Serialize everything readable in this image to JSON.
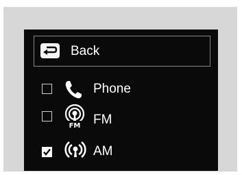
{
  "menu": {
    "back": {
      "label": "Back",
      "icon": "back-arrow-icon"
    },
    "items": [
      {
        "label": "Phone",
        "icon": "phone-icon",
        "checked": false
      },
      {
        "label": "FM",
        "icon": "fm-radio-icon",
        "icon_text": "FM",
        "checked": false
      },
      {
        "label": "AM",
        "icon": "am-radio-icon",
        "checked": true
      }
    ]
  }
}
